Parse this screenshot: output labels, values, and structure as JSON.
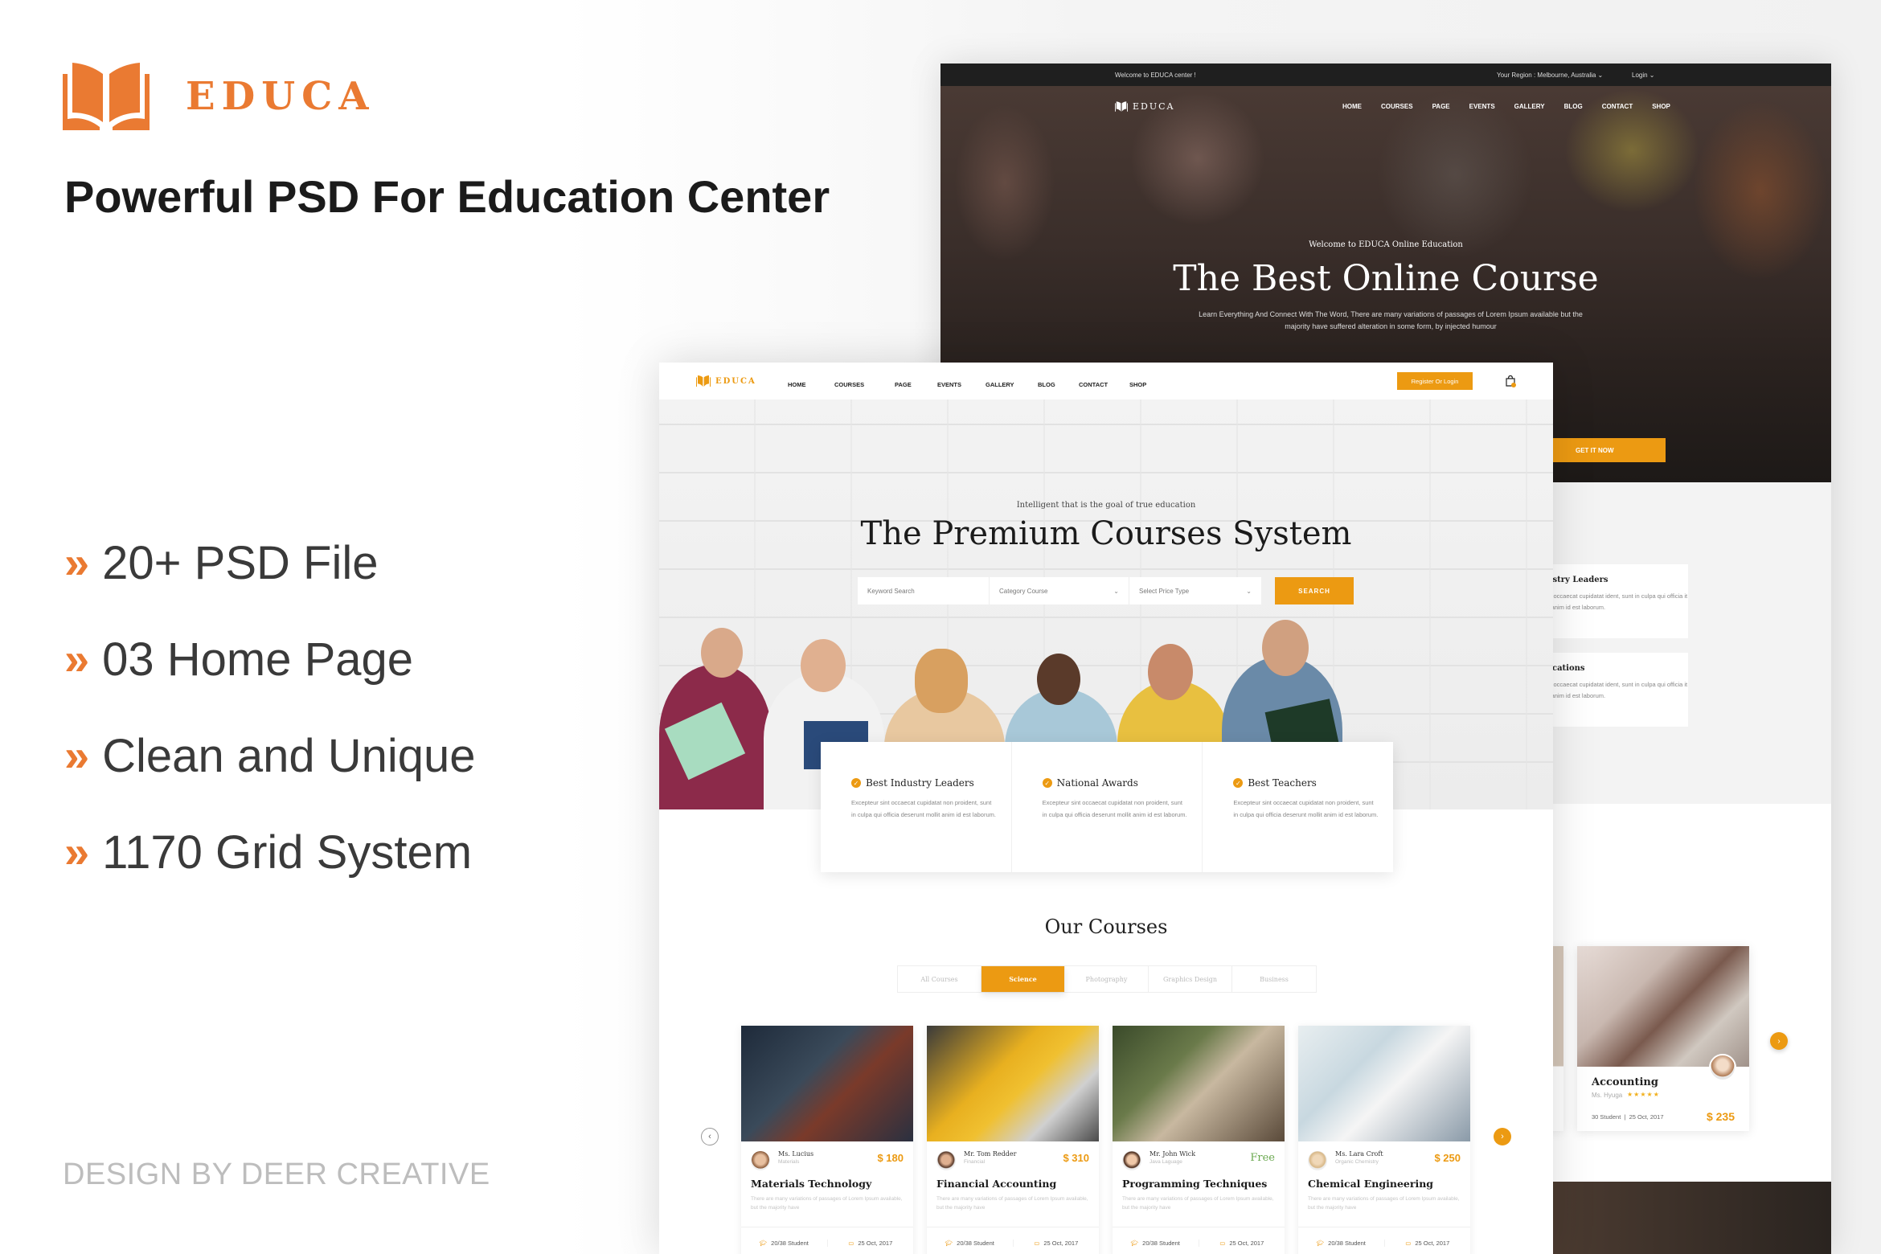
{
  "brand": {
    "name": "EDUCA",
    "logo_icon": "open-book-icon",
    "accent_color": "#ea7a32"
  },
  "tagline": "Powerful PSD For Education Center",
  "features": [
    {
      "icon": "double-chevron-icon",
      "label": "20+ PSD File"
    },
    {
      "icon": "double-chevron-icon",
      "label": "03 Home Page"
    },
    {
      "icon": "double-chevron-icon",
      "label": "Clean and Unique"
    },
    {
      "icon": "double-chevron-icon",
      "label": "1170 Grid System"
    }
  ],
  "credit": "DESIGN BY DEER CREATIVE",
  "back_mockup": {
    "topbar": {
      "welcome": "Welcome to EDUCA center !",
      "region": "Your Region : Melbourne, Australia ⌄",
      "login": "Login ⌄"
    },
    "logo": "EDUCA",
    "menu": [
      "HOME",
      "COURSES",
      "PAGE",
      "EVENTS",
      "GALLERY",
      "BLOG",
      "CONTACT",
      "SHOP"
    ],
    "hero": {
      "welcome": "Welcome to EDUCA Online Education",
      "title": "The Best Online Course",
      "description": "Learn Everything And Connect With The Word, There are many variations of passages of Lorem Ipsum available but the majority have suffered alteration in some form, by injected humour",
      "cta": "GET IT NOW"
    },
    "feature_cards": [
      {
        "title": "ndustry Leaders",
        "text": "ur sint occaecat cupidatat ident, sunt in culpa qui officia it mollit anim id est laborum."
      },
      {
        "title": "l Locations",
        "text": "ur sint occaecat cupidatat ident, sunt in culpa qui officia it mollit anim id est laborum."
      }
    ],
    "course_card": {
      "title": "Accounting",
      "instructor": "Ms. Hyuga",
      "stars": "★★★★★",
      "students": "30 Student",
      "date": "25 Oct, 2017",
      "price": "$ 235"
    },
    "next_arrow": "›"
  },
  "front_mockup": {
    "logo": "EDUCA",
    "menu": [
      "HOME",
      "COURSES",
      "PAGE",
      "EVENTS",
      "GALLERY",
      "BLOG",
      "CONTACT",
      "SHOP"
    ],
    "register_button": "Register Or Login",
    "cart_icon": "shopping-bag-icon",
    "hero": {
      "subtitle": "Intelligent that is the goal of true education",
      "title": "The Premium Courses System",
      "search": {
        "keyword_placeholder": "Keyword Search",
        "category_placeholder": "Category Course",
        "price_placeholder": "Select Price Type",
        "button": "SEARCH"
      }
    },
    "highlights": [
      {
        "title": "Best Industry Leaders",
        "text": "Excepteur sint occaecat cupidatat non proident, sunt in culpa qui officia deserunt mollit anim id est laborum."
      },
      {
        "title": "National Awards",
        "text": "Excepteur sint occaecat cupidatat non proident, sunt in culpa qui officia deserunt mollit anim id est laborum."
      },
      {
        "title": "Best Teachers",
        "text": "Excepteur sint occaecat cupidatat non proident, sunt in culpa qui officia deserunt mollit anim id est laborum."
      }
    ],
    "courses_title": "Our Courses",
    "tabs": [
      {
        "label": "All Courses",
        "active": false
      },
      {
        "label": "Science",
        "active": true
      },
      {
        "label": "Photography",
        "active": false
      },
      {
        "label": "Graphics Design",
        "active": false
      },
      {
        "label": "Business",
        "active": false
      }
    ],
    "courses": [
      {
        "instructor": "Ms. Lucius",
        "role": "Materials",
        "price": "$ 180",
        "title": "Materials Technology",
        "desc": "There are many variations of passages of Lorem Ipsum available, but the majority have",
        "students": "20/38 Student",
        "date": "25 Oct, 2017"
      },
      {
        "instructor": "Mr. Tom Redder",
        "role": "Financial",
        "price": "$ 310",
        "title": "Financial Accounting",
        "desc": "There are many variations of passages of Lorem Ipsum available, but the majority have",
        "students": "20/38 Student",
        "date": "25 Oct, 2017"
      },
      {
        "instructor": "Mr. John Wick",
        "role": "Java Laguage",
        "price": "Free",
        "title": "Programming Techniques",
        "desc": "There are many variations of passages of Lorem Ipsum available, but the majority have",
        "students": "20/38 Student",
        "date": "25 Oct, 2017"
      },
      {
        "instructor": "Ms. Lara Croft",
        "role": "Organic Chemistry",
        "price": "$ 250",
        "title": "Chemical Engineering",
        "desc": "There are many variations of passages of Lorem Ipsum available, but the majority have",
        "students": "20/38 Student",
        "date": "25 Oct, 2017"
      }
    ],
    "prev_arrow": "‹",
    "next_arrow": "›",
    "accent_color": "#ec9a12"
  }
}
